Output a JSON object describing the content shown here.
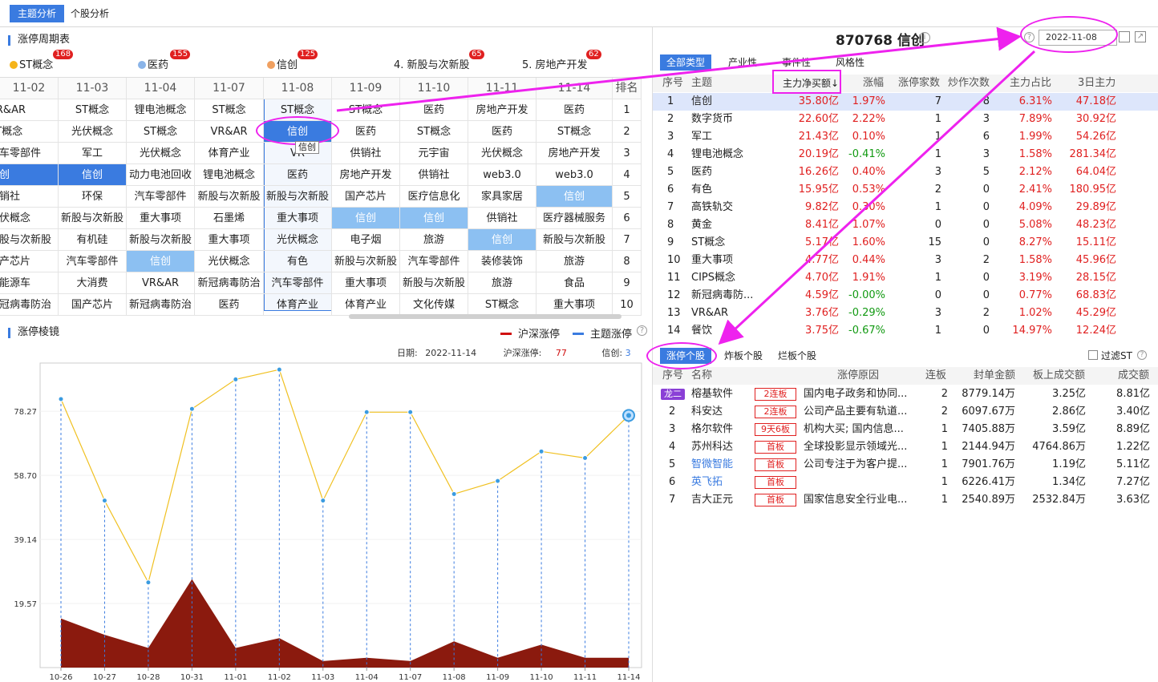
{
  "top_tabs": [
    "主题分析",
    "个股分析"
  ],
  "section1_title": "涨停周期表",
  "themes": [
    {
      "name": "ST概念",
      "count": "168",
      "dot": "#f5b41a"
    },
    {
      "name": "医药",
      "count": "155",
      "dot": "#8ab4e8"
    },
    {
      "name": "信创",
      "count": "125",
      "dot": "#f0a060"
    },
    {
      "name": "4. 新股与次新股",
      "count": "65",
      "dot": ""
    },
    {
      "name": "5. 房地产开发",
      "count": "62",
      "dot": ""
    }
  ],
  "grid_headers": [
    "11-02",
    "11-03",
    "11-04",
    "11-07",
    "11-08",
    "11-09",
    "11-10",
    "11-11",
    "11-14",
    "排名"
  ],
  "grid": [
    [
      "VR&AR",
      "ST概念",
      "锂电池概念",
      "ST概念",
      "ST概念",
      "ST概念",
      "医药",
      "房地产开发",
      "医药",
      "1"
    ],
    [
      "ST概念",
      "光伏概念",
      "ST概念",
      "VR&AR",
      "信创",
      "医药",
      "ST概念",
      "医药",
      "ST概念",
      "2"
    ],
    [
      "汽车零部件",
      "军工",
      "光伏概念",
      "体育产业",
      "VR",
      "供销社",
      "元宇宙",
      "光伏概念",
      "房地产开发",
      "3"
    ],
    [
      "信创",
      "信创",
      "动力电池回收",
      "锂电池概念",
      "医药",
      "房地产开发",
      "供销社",
      "web3.0",
      "web3.0",
      "4"
    ],
    [
      "供销社",
      "环保",
      "汽车零部件",
      "新股与次新股",
      "新股与次新股",
      "国产芯片",
      "医疗信息化",
      "家具家居",
      "信创",
      "5"
    ],
    [
      "光伏概念",
      "新股与次新股",
      "重大事项",
      "石墨烯",
      "重大事项",
      "信创",
      "信创",
      "供销社",
      "医疗器械服务",
      "6"
    ],
    [
      "新股与次新股",
      "有机硅",
      "新股与次新股",
      "重大事项",
      "光伏概念",
      "电子烟",
      "旅游",
      "信创",
      "新股与次新股",
      "7"
    ],
    [
      "国产芯片",
      "汽车零部件",
      "信创",
      "光伏概念",
      "有色",
      "新股与次新股",
      "汽车零部件",
      "装修装饰",
      "旅游",
      "8"
    ],
    [
      "新能源车",
      "大消费",
      "VR&AR",
      "新冠病毒防治",
      "汽车零部件",
      "重大事项",
      "新股与次新股",
      "旅游",
      "食品",
      "9"
    ],
    [
      "新冠病毒防治",
      "国产芯片",
      "新冠病毒防治",
      "医药",
      "体育产业",
      "体育产业",
      "文化传媒",
      "ST概念",
      "重大事项",
      "10"
    ]
  ],
  "tooltip": "信创",
  "section2_title": "涨停棱镜",
  "legend": {
    "a": "沪深涨停",
    "b": "主题涨停"
  },
  "chart_info": {
    "date_label": "日期:",
    "date": "2022-11-14",
    "hs_label": "沪深涨停:",
    "hs": "77",
    "xc_label": "信创:",
    "xc": "3"
  },
  "chart_data": {
    "type": "line",
    "x": [
      "10-26",
      "10-27",
      "10-28",
      "10-31",
      "11-01",
      "11-02",
      "11-03",
      "11-04",
      "11-07",
      "11-08",
      "11-09",
      "11-10",
      "11-11",
      "11-14"
    ],
    "y_ticks": [
      "78.27",
      "58.70",
      "39.14",
      "19.57"
    ],
    "ylim": [
      0,
      93
    ],
    "series": [
      {
        "name": "沪深涨停",
        "type": "area",
        "color": "#8b1a0e",
        "values": [
          15,
          10,
          6,
          27,
          6,
          9,
          2,
          3,
          2,
          8,
          3,
          7,
          3,
          3
        ]
      },
      {
        "name": "主题涨停",
        "type": "line",
        "color": "#f0c020",
        "values": [
          82,
          51,
          26,
          79,
          88,
          91,
          51,
          78,
          78,
          53,
          57,
          66,
          64,
          77
        ]
      }
    ]
  },
  "stock_title": "870768 信创",
  "date_value": "2022-11-08",
  "right_tabs": [
    "全部类型",
    "产业性",
    "事件性",
    "风格性"
  ],
  "theme_table": {
    "headers": [
      "序号",
      "主题",
      "主力净买额↓",
      "涨幅",
      "涨停家数",
      "炒作次数",
      "主力占比",
      "3日主力"
    ],
    "rows": [
      [
        "1",
        "信创",
        "35.80亿",
        "1.97%",
        "7",
        "8",
        "6.31%",
        "47.18亿"
      ],
      [
        "2",
        "数字货币",
        "22.60亿",
        "2.22%",
        "1",
        "3",
        "7.89%",
        "30.92亿"
      ],
      [
        "3",
        "军工",
        "21.43亿",
        "0.10%",
        "1",
        "6",
        "1.99%",
        "54.26亿"
      ],
      [
        "4",
        "锂电池概念",
        "20.19亿",
        "-0.41%",
        "1",
        "3",
        "1.58%",
        "281.34亿"
      ],
      [
        "5",
        "医药",
        "16.26亿",
        "0.40%",
        "3",
        "5",
        "2.12%",
        "64.04亿"
      ],
      [
        "6",
        "有色",
        "15.95亿",
        "0.53%",
        "2",
        "0",
        "2.41%",
        "180.95亿"
      ],
      [
        "7",
        "高铁轨交",
        "9.82亿",
        "0.30%",
        "1",
        "0",
        "4.09%",
        "29.89亿"
      ],
      [
        "8",
        "黄金",
        "8.41亿",
        "1.07%",
        "0",
        "0",
        "5.08%",
        "48.23亿"
      ],
      [
        "9",
        "ST概念",
        "5.17亿",
        "1.60%",
        "15",
        "0",
        "8.27%",
        "15.11亿"
      ],
      [
        "10",
        "重大事项",
        "4.77亿",
        "0.44%",
        "3",
        "2",
        "1.58%",
        "45.96亿"
      ],
      [
        "11",
        "CIPS概念",
        "4.70亿",
        "1.91%",
        "1",
        "0",
        "3.19%",
        "28.15亿"
      ],
      [
        "12",
        "新冠病毒防...",
        "4.59亿",
        "-0.00%",
        "0",
        "0",
        "0.77%",
        "68.83亿"
      ],
      [
        "13",
        "VR&AR",
        "3.76亿",
        "-0.29%",
        "3",
        "2",
        "1.02%",
        "45.29亿"
      ],
      [
        "14",
        "餐饮",
        "3.75亿",
        "-0.67%",
        "1",
        "0",
        "14.97%",
        "12.24亿"
      ]
    ]
  },
  "lower_tabs": [
    "涨停个股",
    "炸板个股",
    "烂板个股"
  ],
  "filter_st": "过滤ST",
  "stock_table": {
    "headers": [
      "序号",
      "名称",
      "涨停原因",
      "连板",
      "封单金额",
      "板上成交额",
      "成交额"
    ],
    "rows": [
      [
        "龙二",
        "榕基软件",
        "2连板",
        "国内电子政务和协同...",
        "2",
        "8779.14万",
        "3.25亿",
        "8.81亿"
      ],
      [
        "2",
        "科安达",
        "2连板",
        "公司产品主要有轨道...",
        "2",
        "6097.67万",
        "2.86亿",
        "3.40亿"
      ],
      [
        "3",
        "格尔软件",
        "9天6板",
        "机构大买; 国内信息...",
        "1",
        "7405.88万",
        "3.59亿",
        "8.89亿"
      ],
      [
        "4",
        "苏州科达",
        "首板",
        "全球投影显示领域光...",
        "1",
        "2144.94万",
        "4764.86万",
        "1.22亿"
      ],
      [
        "5",
        "智微智能",
        "首板",
        "公司专注于为客户提...",
        "1",
        "7901.76万",
        "1.19亿",
        "5.11亿"
      ],
      [
        "6",
        "英飞拓",
        "首板",
        "",
        "1",
        "6226.41万",
        "1.34亿",
        "7.27亿"
      ],
      [
        "7",
        "吉大正元",
        "首板",
        "国家信息安全行业电...",
        "1",
        "2540.89万",
        "2532.84万",
        "3.63亿"
      ]
    ]
  }
}
